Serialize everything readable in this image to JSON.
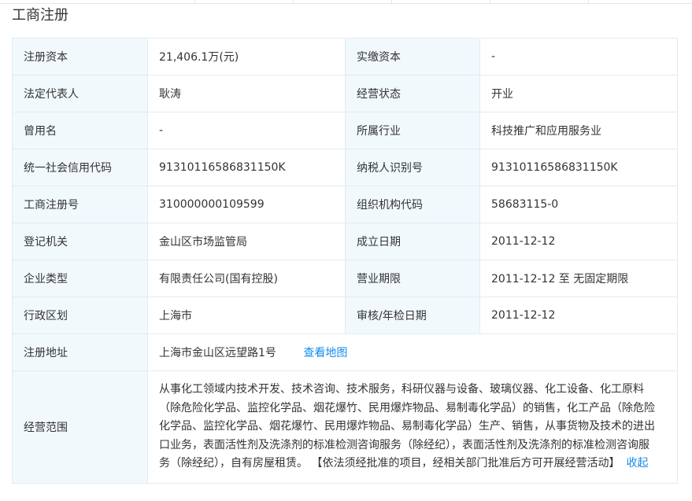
{
  "page": {
    "title": "工商注册"
  },
  "rows": [
    {
      "l1": "注册资本",
      "v1": "21,406.1万(元)",
      "l2": "实缴资本",
      "v2": "-"
    },
    {
      "l1": "法定代表人",
      "v1": "耿涛",
      "l2": "经营状态",
      "v2": "开业"
    },
    {
      "l1": "曾用名",
      "v1": "-",
      "l2": "所属行业",
      "v2": "科技推广和应用服务业"
    },
    {
      "l1": "统一社会信用代码",
      "v1": "91310116586831150K",
      "l2": "纳税人识别号",
      "v2": "91310116586831150K"
    },
    {
      "l1": "工商注册号",
      "v1": "310000000109599",
      "l2": "组织机构代码",
      "v2": "58683115-0"
    },
    {
      "l1": "登记机关",
      "v1": "金山区市场监管局",
      "l2": "成立日期",
      "v2": "2011-12-12"
    },
    {
      "l1": "企业类型",
      "v1": "有限责任公司(国有控股)",
      "l2": "营业期限",
      "v2": "2011-12-12 至 无固定期限"
    },
    {
      "l1": "行政区划",
      "v1": "上海市",
      "l2": "审核/年检日期",
      "v2": "2011-12-12"
    }
  ],
  "address": {
    "label": "注册地址",
    "value": "上海市金山区远望路1号",
    "map_link": "查看地图"
  },
  "scope": {
    "label": "经营范围",
    "text": "从事化工领域内技术开发、技术咨询、技术服务，科研仪器与设备、玻璃仪器、化工设备、化工原料（除危险化学品、监控化学品、烟花爆竹、民用爆炸物品、易制毒化学品）的销售，化工产品（除危险化学品、监控化学品、烟花爆竹、民用爆炸物品、易制毒化学品）生产、销售，从事货物及技术的进出口业务，表面活性剂及洗涤剂的标准检测咨询服务（除经纪），表面活性剂及洗涤剂的标准检测咨询服务（除经纪），自有房屋租赁。 【依法须经批准的项目，经相关部门批准后方可开展经营活动】",
    "collapse_link": "收起"
  },
  "colors": {
    "label_bg": "#f2f9fc",
    "border": "#e4eaf2",
    "link": "#128bed",
    "text": "#333333"
  }
}
